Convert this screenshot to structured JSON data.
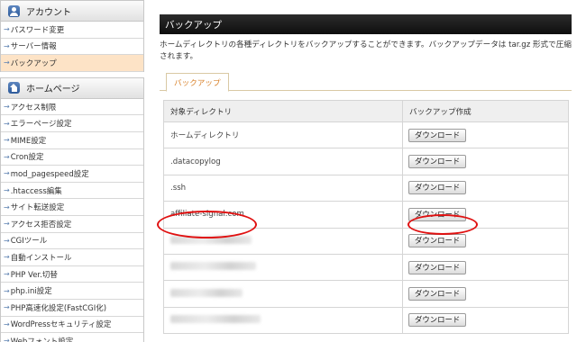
{
  "sidebar": {
    "account": {
      "title": "アカウント",
      "items": [
        {
          "label": "パスワード変更"
        },
        {
          "label": "サーバー情報"
        },
        {
          "label": "バックアップ",
          "active": true
        }
      ]
    },
    "homepage": {
      "title": "ホームページ",
      "items": [
        {
          "label": "アクセス制限"
        },
        {
          "label": "エラーページ設定"
        },
        {
          "label": "MIME設定"
        },
        {
          "label": "Cron設定"
        },
        {
          "label": "mod_pagespeed設定"
        },
        {
          "label": ".htaccess編集"
        },
        {
          "label": "サイト転送設定"
        },
        {
          "label": "アクセス拒否設定"
        },
        {
          "label": "CGIツール"
        },
        {
          "label": "自動インストール"
        },
        {
          "label": "PHP Ver.切替"
        },
        {
          "label": "php.ini設定"
        },
        {
          "label": "PHP高速化設定(FastCGI化)"
        },
        {
          "label": "WordPressセキュリティ設定"
        },
        {
          "label": "Webフォント設定"
        }
      ]
    }
  },
  "main": {
    "title": "バックアップ",
    "description": "ホームディレクトリの各種ディレクトリをバックアップすることができます。バックアップデータは tar.gz 形式で圧縮されます。",
    "tab": "バックアップ",
    "table": {
      "headers": [
        "対象ディレクトリ",
        "バックアップ作成"
      ],
      "button_label": "ダウンロード",
      "rows": [
        {
          "dir": "ホームディレクトリ",
          "blurred": false
        },
        {
          "dir": ".datacopylog",
          "blurred": false
        },
        {
          "dir": ".ssh",
          "blurred": false
        },
        {
          "dir": "affiliate-signal.com",
          "blurred": false,
          "highlighted": true
        },
        {
          "dir": "",
          "blurred": true
        },
        {
          "dir": "",
          "blurred": true
        },
        {
          "dir": "",
          "blurred": true
        },
        {
          "dir": "",
          "blurred": true
        }
      ]
    }
  },
  "colors": {
    "active_item": "#fde3c6",
    "tab_text": "#d9822b",
    "highlight_ring": "#e01010",
    "title_bar": "#111111"
  }
}
